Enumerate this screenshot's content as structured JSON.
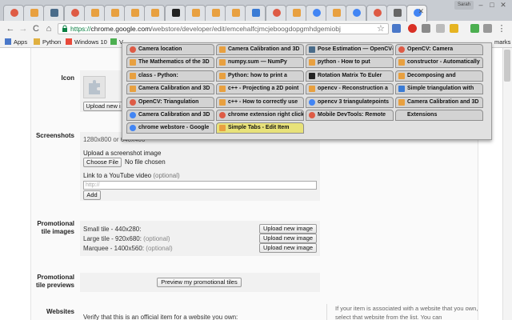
{
  "window": {
    "profile_label": "Sarah",
    "controls": [
      "–",
      "□",
      "✕"
    ]
  },
  "tabs": [
    {
      "icon": "chrome-icon",
      "color": "#de5b45"
    },
    {
      "icon": "pinwheel-icon",
      "color": "#e8a040"
    },
    {
      "icon": "table-icon",
      "color": "#4a6c8a"
    },
    {
      "icon": "chrome-icon",
      "color": "#de5b45"
    },
    {
      "icon": "pinwheel-icon",
      "color": "#e8a040"
    },
    {
      "icon": "pinwheel-icon",
      "color": "#e8a040"
    },
    {
      "icon": "pinwheel-icon",
      "color": "#e8a040"
    },
    {
      "icon": "pinwheel-icon",
      "color": "#e8a040"
    },
    {
      "icon": "g-black-icon",
      "color": "#222222"
    },
    {
      "icon": "pinwheel-icon",
      "color": "#e8a040"
    },
    {
      "icon": "pinwheel-icon",
      "color": "#e8a040"
    },
    {
      "icon": "pinwheel-icon",
      "color": "#e8a040"
    },
    {
      "icon": "mit-icon",
      "color": "#3a7bd5"
    },
    {
      "icon": "chrome-icon",
      "color": "#de5b45"
    },
    {
      "icon": "pinwheel-icon",
      "color": "#e8a040"
    },
    {
      "icon": "google-icon",
      "color": "#4285f4"
    },
    {
      "icon": "pinwheel-icon",
      "color": "#e8a040"
    },
    {
      "icon": "google-icon",
      "color": "#4285f4"
    },
    {
      "icon": "chrome-icon",
      "color": "#de5b45"
    },
    {
      "icon": "puzzle-icon",
      "color": "#666666"
    },
    {
      "icon": "google-icon",
      "color": "#4285f4",
      "active": true
    }
  ],
  "toolbar": {
    "back": "←",
    "forward": "→",
    "reload": "C",
    "home": "⌂",
    "url_scheme": "https://",
    "url_host": "chrome.google.com",
    "url_path": "/webstore/developer/edit/emcehalfcjmcjeboogdopgmhdgemiobj",
    "star": "☆"
  },
  "bookmarks": {
    "items": [
      {
        "label": "Apps",
        "color": "#4a78c9"
      },
      {
        "label": "Python",
        "color": "#e0b040"
      },
      {
        "label": "Windows 10",
        "color": "#e8493a"
      },
      {
        "label": "V",
        "color": "#4caf50"
      }
    ],
    "overflow": "marks"
  },
  "form": {
    "icon_label": "Icon",
    "upload_icon_button": "Upload new i",
    "screenshots_label": "Screenshots",
    "screenshots_size": "1280x800 or 640x400",
    "upload_screenshot_label": "Upload a screenshot image",
    "choose_file_button": "Choose File",
    "no_file_text": "No file chosen",
    "youtube_label": "Link to a YouTube video",
    "youtube_optional": "(optional)",
    "youtube_placeholder": "http://",
    "add_button": "Add",
    "promo_images_label_1": "Promotional",
    "promo_images_label_2": "tile images",
    "small_tile": "Small tile - 440x280:",
    "large_tile": "Large tile - 920x680:",
    "large_optional": "(optional)",
    "marquee": "Marquee - 1400x560:",
    "marquee_optional": "(optional)",
    "upload_new_image": "Upload new image",
    "promo_previews_label_1": "Promotional",
    "promo_previews_label_2": "tile previews",
    "preview_button": "Preview my promotional tiles",
    "websites_label": "Websites",
    "verify_text": "Verify that this is an official item for a website you own:",
    "side_text": "If your item is associated with a website that you own, select that website from the list. You can"
  },
  "popup": {
    "tabs": [
      {
        "title": "Camera location",
        "icon": "chrome-icon",
        "color": "#de5b45"
      },
      {
        "title": "Camera Calibration and 3D",
        "icon": "pinwheel-icon",
        "color": "#e8a040"
      },
      {
        "title": "Pose Estimation — OpenCV-",
        "icon": "table-icon",
        "color": "#4a6c8a"
      },
      {
        "title": "OpenCV: Camera",
        "icon": "chrome-icon",
        "color": "#de5b45"
      },
      {
        "title": "The Mathematics of the 3D",
        "icon": "pinwheel-icon",
        "color": "#e8a040"
      },
      {
        "title": "numpy.sum — NumPy",
        "icon": "pinwheel-icon",
        "color": "#e8a040"
      },
      {
        "title": "python - How to put",
        "icon": "pinwheel-icon",
        "color": "#e8a040"
      },
      {
        "title": "constructor - Automatically",
        "icon": "pinwheel-icon",
        "color": "#e8a040"
      },
      {
        "title": "class - Python:",
        "icon": "pinwheel-icon",
        "color": "#e8a040"
      },
      {
        "title": "Python: how to print a",
        "icon": "pinwheel-icon",
        "color": "#e8a040"
      },
      {
        "title": "Rotation Matrix To Euler",
        "icon": "g-black-icon",
        "color": "#222222"
      },
      {
        "title": "Decomposing and",
        "icon": "pinwheel-icon",
        "color": "#e8a040"
      },
      {
        "title": "Camera Calibration and 3D",
        "icon": "pinwheel-icon",
        "color": "#e8a040"
      },
      {
        "title": "c++ - Projecting a 2D point",
        "icon": "pinwheel-icon",
        "color": "#e8a040"
      },
      {
        "title": "opencv - Reconstruction a",
        "icon": "pinwheel-icon",
        "color": "#e8a040"
      },
      {
        "title": "Simple triangulation with",
        "icon": "mit-icon",
        "color": "#3a7bd5"
      },
      {
        "title": "OpenCV: Triangulation",
        "icon": "chrome-icon",
        "color": "#de5b45"
      },
      {
        "title": "c++ - How to correctly use",
        "icon": "pinwheel-icon",
        "color": "#e8a040"
      },
      {
        "title": "opencv 3 triangulatepoints",
        "icon": "google-icon",
        "color": "#4285f4"
      },
      {
        "title": "Camera Calibration and 3D",
        "icon": "pinwheel-icon",
        "color": "#e8a040"
      },
      {
        "title": "Camera Calibration and 3D",
        "icon": "google-icon",
        "color": "#4285f4"
      },
      {
        "title": "chrome extension right click",
        "icon": "chrome-icon",
        "color": "#de5b45"
      },
      {
        "title": "Mobile DevTools: Remote",
        "icon": "chrome-icon",
        "color": "#de5b45"
      },
      {
        "title": "Extensions",
        "icon": "",
        "color": ""
      },
      {
        "title": "chrome webstore - Google",
        "icon": "google-icon",
        "color": "#4285f4"
      },
      {
        "title": "Simple Tabs - Edit Item",
        "icon": "pinwheel-icon",
        "color": "#e8a040",
        "selected": true
      }
    ]
  }
}
